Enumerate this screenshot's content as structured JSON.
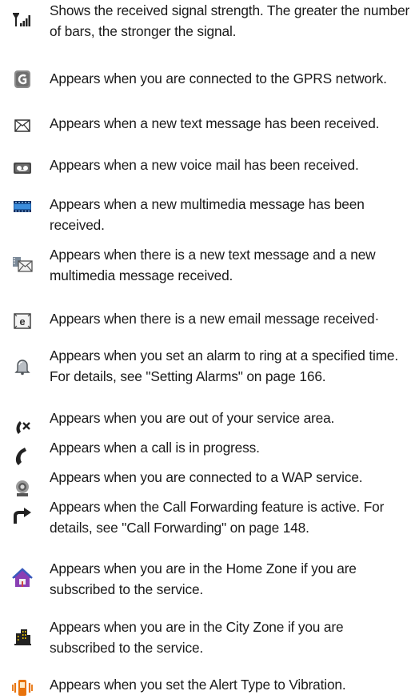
{
  "icons": [
    {
      "icon": "signal-strength-icon",
      "text": "Shows the received signal strength. The greater the number of bars, the stronger the signal."
    },
    {
      "icon": "gprs-icon",
      "text": "Appears when you are connected to the GPRS network."
    },
    {
      "icon": "text-message-icon",
      "text": "Appears when a new text message has been received."
    },
    {
      "icon": "voice-mail-icon",
      "text": "Appears when a new voice mail has been received."
    },
    {
      "icon": "multimedia-message-icon",
      "text": "Appears when a new multimedia message has been received."
    },
    {
      "icon": "text-and-multimedia-message-icon",
      "text": "Appears when there is a new text message and a new multimedia message received."
    },
    {
      "icon": "email-icon",
      "text": "Appears when there is a new email message received·"
    },
    {
      "icon": "alarm-icon",
      "text": "Appears when you set an alarm to ring at a specified time. For details, see \"Setting Alarms\" on page 166."
    },
    {
      "icon": "no-service-icon",
      "text": "Appears when you are out of your service area."
    },
    {
      "icon": "call-in-progress-icon",
      "text": "Appears when a call is in progress."
    },
    {
      "icon": "wap-icon",
      "text": "Appears when you are connected to a WAP service."
    },
    {
      "icon": "call-forwarding-icon",
      "text": "Appears when the Call Forwarding feature is active. For details, see \"Call Forwarding\" on page 148."
    },
    {
      "icon": "home-zone-icon",
      "text": "Appears when you are in the Home Zone if you are subscribed to the service."
    },
    {
      "icon": "city-zone-icon",
      "text": "Appears when you are in the City Zone if you are subscribed to the service."
    },
    {
      "icon": "vibration-icon",
      "text": "Appears when you set the Alert Type to Vibration."
    }
  ]
}
